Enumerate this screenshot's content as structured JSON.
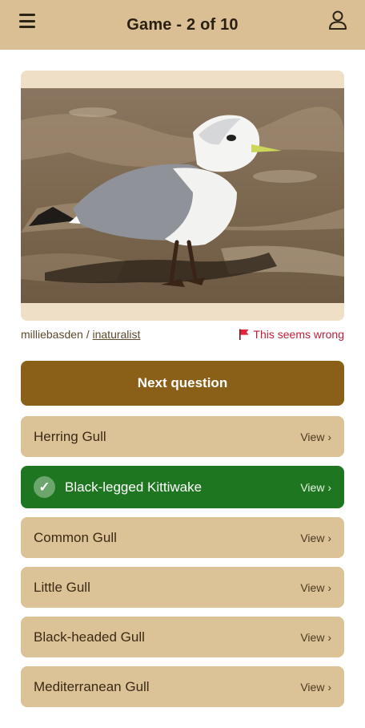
{
  "header": {
    "title": "Game - 2 of 10",
    "menu_icon": "hamburger-menu-icon",
    "user_icon": "user-profile-icon"
  },
  "photo": {
    "credit_user": "milliebasden",
    "credit_sep": " / ",
    "credit_source": "inaturalist",
    "report_label": "This seems wrong",
    "report_icon": "red-flag-icon"
  },
  "next_button": {
    "label": "Next question"
  },
  "answers": [
    {
      "name": "Herring Gull",
      "view": "View ›",
      "correct": false
    },
    {
      "name": "Black-legged Kittiwake",
      "view": "View ›",
      "correct": true,
      "check_glyph": "✓"
    },
    {
      "name": "Common Gull",
      "view": "View ›",
      "correct": false
    },
    {
      "name": "Little Gull",
      "view": "View ›",
      "correct": false
    },
    {
      "name": "Black-headed Gull",
      "view": "View ›",
      "correct": false
    },
    {
      "name": "Mediterranean Gull",
      "view": "View ›",
      "correct": false
    }
  ],
  "colors": {
    "header_bg": "#d9bf93",
    "primary_button": "#8a5f17",
    "answer_bg": "#dcc397",
    "correct_bg": "#1e7720",
    "report_text": "#b8203a"
  }
}
